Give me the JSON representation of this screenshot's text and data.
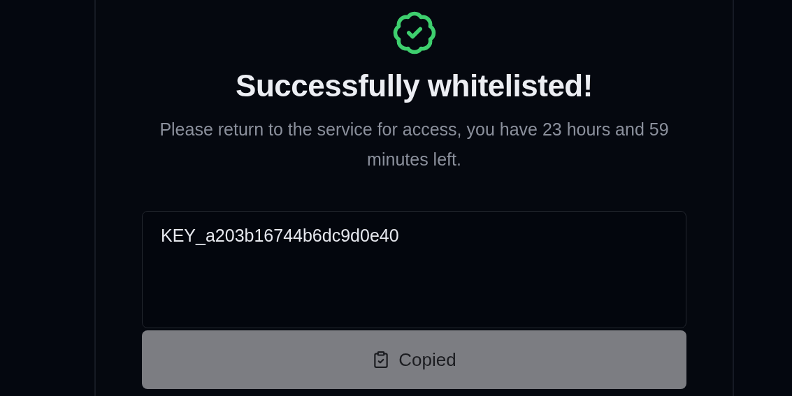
{
  "status": {
    "title": "Successfully whitelisted!",
    "message": "Please return to the service for access, you have 23 hours and 59 minutes left."
  },
  "key_field": {
    "value": "KEY_a203b16744b6dc9d0e40"
  },
  "copy_button": {
    "label": "Copied"
  }
}
